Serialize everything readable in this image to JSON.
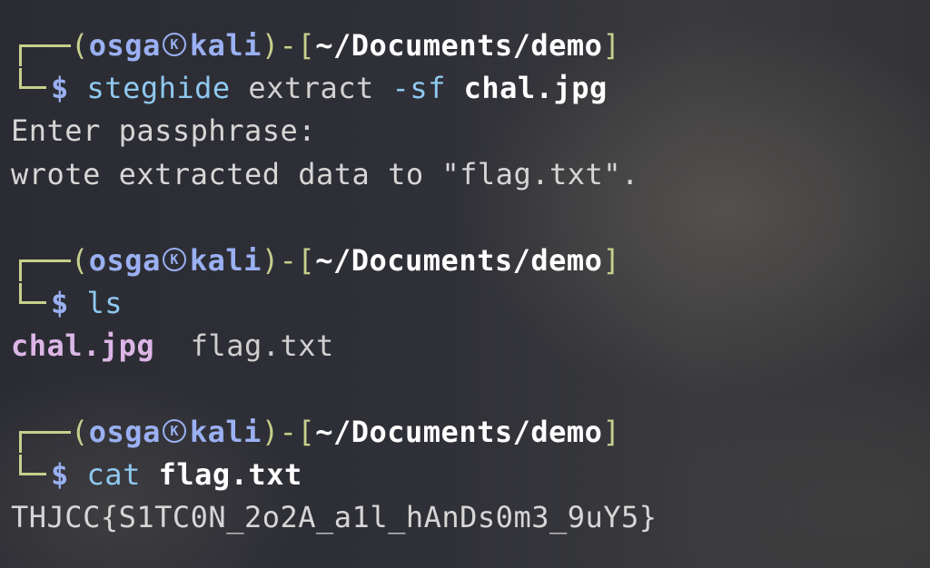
{
  "prompt": {
    "open_paren": "(",
    "user": "osga",
    "host": "kali",
    "close_paren_dash": ")-",
    "open_bracket": "[",
    "path": "~/Documents/demo",
    "close_bracket": "]",
    "dollar": "$",
    "icon": "kali-dragon-icon",
    "icon_glyph": "K"
  },
  "blocks": [
    {
      "command": "steghide",
      "args_plain": "extract",
      "args_option": "-sf",
      "args_bold": "chal.jpg",
      "output": [
        "Enter passphrase:",
        "wrote extracted data to \"flag.txt\"."
      ]
    },
    {
      "command": "ls",
      "files": [
        "chal.jpg",
        "flag.txt"
      ]
    },
    {
      "command": "cat",
      "args_bold": "flag.txt",
      "output": [
        "THJCC{S1TC0N_2o2A_a1l_hAnDs0m3_9uY5}"
      ]
    }
  ],
  "colors": {
    "prompt_frame": "#c6d08c",
    "user_host": "#9ab0f2",
    "command": "#8fc9f0",
    "image_file": "#dcb6e6",
    "output_text": "#d6d6d6"
  }
}
